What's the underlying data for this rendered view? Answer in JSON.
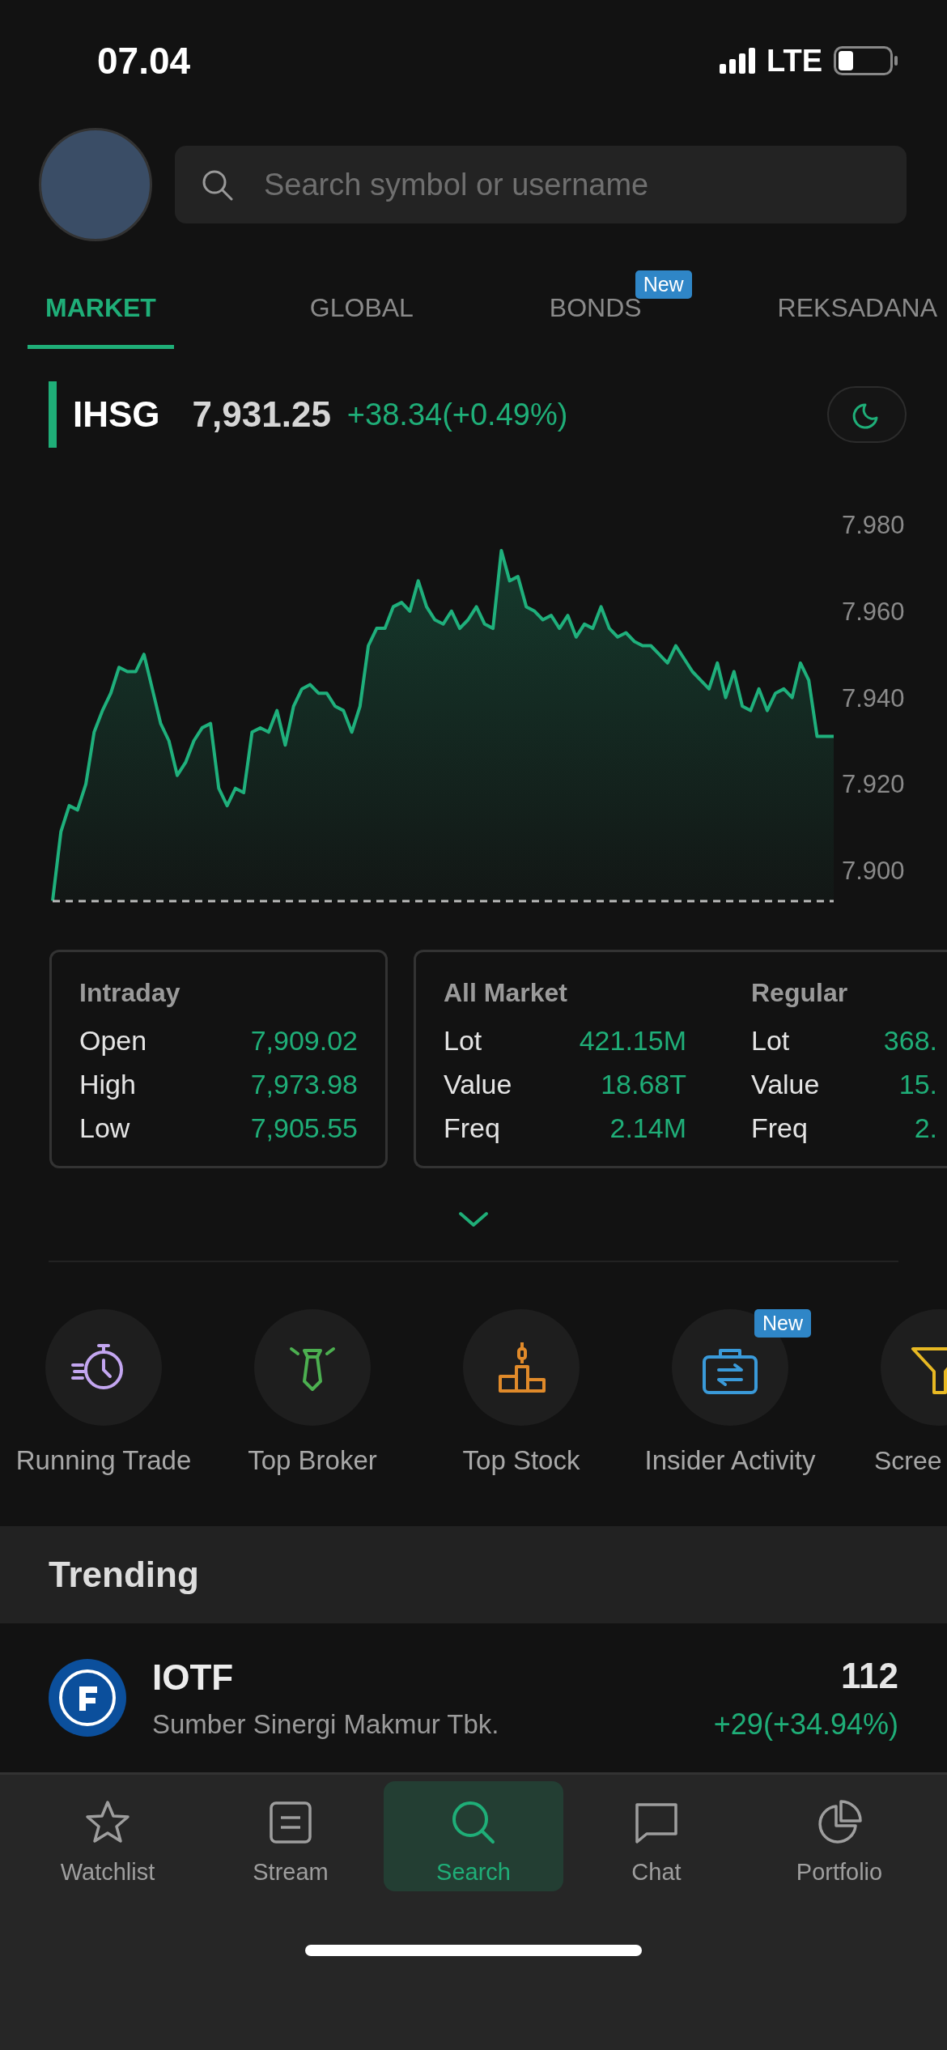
{
  "status_bar": {
    "time": "07.04",
    "network": "LTE"
  },
  "search": {
    "placeholder": "Search symbol or username"
  },
  "tabs": [
    {
      "label": "MARKET",
      "selected": true
    },
    {
      "label": "GLOBAL",
      "selected": false
    },
    {
      "label": "BONDS",
      "selected": false,
      "badge": "New"
    },
    {
      "label": "REKSADANA",
      "selected": false
    }
  ],
  "index": {
    "symbol": "IHSG",
    "price": "7,931.25",
    "change": "+38.34(+0.49%)"
  },
  "chart_data": {
    "type": "area",
    "ylim": [
      7.89291,
      7.98
    ],
    "yticks": [
      {
        "value": 7.98,
        "label": "7.980"
      },
      {
        "value": 7.96,
        "label": "7.960"
      },
      {
        "value": 7.94,
        "label": "7.940"
      },
      {
        "value": 7.92,
        "label": "7.920"
      },
      {
        "value": 7.9,
        "label": "7.900"
      }
    ],
    "series": [
      {
        "color": "#1fb07c",
        "values": [
          7.893,
          7.909,
          7.915,
          7.914,
          7.92,
          7.932,
          7.937,
          7.941,
          7.947,
          7.946,
          7.946,
          7.95,
          7.942,
          7.934,
          7.93,
          7.922,
          7.925,
          7.93,
          7.933,
          7.934,
          7.919,
          7.915,
          7.919,
          7.918,
          7.932,
          7.933,
          7.932,
          7.937,
          7.929,
          7.938,
          7.942,
          7.943,
          7.941,
          7.941,
          7.938,
          7.937,
          7.932,
          7.938,
          7.952,
          7.956,
          7.956,
          7.961,
          7.962,
          7.96,
          7.967,
          7.961,
          7.958,
          7.957,
          7.96,
          7.956,
          7.958,
          7.961,
          7.957,
          7.956,
          7.974,
          7.967,
          7.968,
          7.961,
          7.96,
          7.958,
          7.959,
          7.956,
          7.959,
          7.954,
          7.957,
          7.956,
          7.961,
          7.956,
          7.954,
          7.955,
          7.953,
          7.952,
          7.952,
          7.95,
          7.948,
          7.952,
          7.949,
          7.946,
          7.944,
          7.942,
          7.948,
          7.94,
          7.946,
          7.938,
          7.937,
          7.942,
          7.937,
          7.941,
          7.942,
          7.94,
          7.948,
          7.944,
          7.931,
          7.931,
          7.931
        ]
      }
    ]
  },
  "intraday": {
    "title": "Intraday",
    "rows": [
      {
        "label": "Open",
        "value": "7,909.02"
      },
      {
        "label": "High",
        "value": "7,973.98"
      },
      {
        "label": "Low",
        "value": "7,905.55"
      }
    ]
  },
  "market_stats": [
    {
      "title": "All Market",
      "rows": [
        {
          "label": "Lot",
          "value": "421.15M"
        },
        {
          "label": "Value",
          "value": "18.68T"
        },
        {
          "label": "Freq",
          "value": "2.14M"
        }
      ]
    },
    {
      "title": "Regular",
      "rows": [
        {
          "label": "Lot",
          "value": "368."
        },
        {
          "label": "Value",
          "value": "15."
        },
        {
          "label": "Freq",
          "value": "2."
        }
      ]
    }
  ],
  "quick_menu": [
    {
      "label": "Running Trade"
    },
    {
      "label": "Top Broker"
    },
    {
      "label": "Top Stock"
    },
    {
      "label": "Insider Activity",
      "badge": "New"
    },
    {
      "label": "Scree"
    }
  ],
  "trending": {
    "title": "Trending",
    "items": [
      {
        "symbol": "IOTF",
        "name": "Sumber Sinergi Makmur Tbk.",
        "price": "112",
        "change": "+29(+34.94%)"
      }
    ]
  },
  "bottom_nav": [
    {
      "label": "Watchlist",
      "selected": false
    },
    {
      "label": "Stream",
      "selected": false
    },
    {
      "label": "Search",
      "selected": true
    },
    {
      "label": "Chat",
      "selected": false
    },
    {
      "label": "Portfolio",
      "selected": false
    }
  ]
}
